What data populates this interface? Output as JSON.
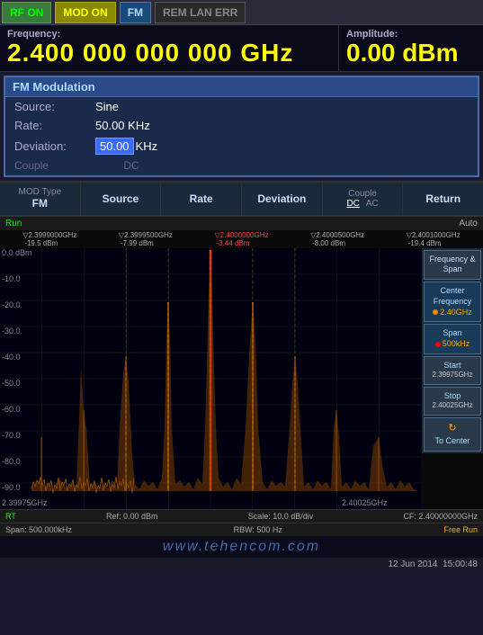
{
  "topbar": {
    "rfon_label": "RF ON",
    "modon_label": "MOD ON",
    "fm_label": "FM",
    "rem_label": "REM LAN ERR"
  },
  "frequency": {
    "label": "Frequency:",
    "value": "2.400 000 000 000 GHz"
  },
  "amplitude": {
    "label": "Amplitude:",
    "value": "0.00  dBm"
  },
  "fm_panel": {
    "title": "FM Modulation",
    "source_label": "Source:",
    "source_value": "Sine",
    "rate_label": "Rate:",
    "rate_value": "50.00 KHz",
    "deviation_label": "Deviation:",
    "deviation_value": "50.00",
    "deviation_unit": "KHz",
    "couple_label": "Couple",
    "couple_value": "DC"
  },
  "mod_buttons": {
    "type_label": "MOD Type",
    "type_value": "FM",
    "source": "Source",
    "rate": "Rate",
    "deviation": "Deviation",
    "couple_label": "Couple",
    "couple_dc": "DC",
    "couple_ac": "AC",
    "return": "Return"
  },
  "spectrum": {
    "run_label": "Run",
    "auto_label": "Auto",
    "markers": [
      {
        "freq": "▽2.3999000GHz",
        "val": "-19.5 dBm"
      },
      {
        "freq": "▽2.3999500GHz",
        "val": "-7.99 dBm"
      },
      {
        "freq": "▽2.4000000GHz",
        "val": "-3.44 dBm"
      },
      {
        "freq": "▽2.4000500GHz",
        "val": "-8.00 dBm"
      },
      {
        "freq": "▽2.4001000GHz",
        "val": "-19.4 dBm"
      }
    ],
    "y_labels": [
      "0.0 dBm",
      "-10.0",
      "-20.0",
      "-30.0",
      "-40.0",
      "-50.0",
      "-60.0",
      "-70.0",
      "-80.0",
      "-90.0"
    ],
    "x_start": "2.39975GHz",
    "x_end": "2.40025GHz"
  },
  "right_panel": {
    "freq_span_label": "Frequency & Span",
    "center_label": "Center Frequency",
    "center_value": "2.40GHz",
    "span_label": "Span",
    "span_value": "500kHz",
    "start_label": "Start",
    "start_value": "2.39975GHz",
    "stop_label": "Stop",
    "stop_value": "2.40025GHz",
    "to_center_label": "To Center"
  },
  "status_bar": {
    "ref_label": "RT",
    "ref_value": "Ref: 0.00 dBm",
    "scale_value": "Scale: 10.0 dB/div",
    "cf_value": "CF: 2.40000000GHz",
    "span_value": "Span: 500.000kHz",
    "rbw_value": "RBW: 500 Hz",
    "free_run": "Free Run"
  },
  "watermark": {
    "text": "www.tehencom.com"
  },
  "datetime": {
    "date": "12 Jun 2014",
    "time": "15:00:48"
  }
}
